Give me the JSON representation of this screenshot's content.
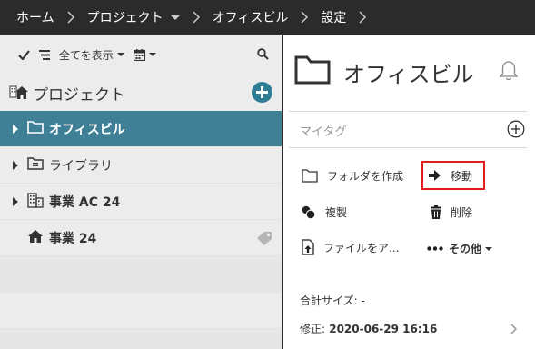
{
  "breadcrumb": {
    "home": "ホーム",
    "project": "プロジェクト",
    "folder": "オフィスビル",
    "settings": "設定"
  },
  "toolbar": {
    "show_all_label": "全てを表示"
  },
  "tree": {
    "root_label": "プロジェクト",
    "items": [
      {
        "label": "オフィスビル",
        "selected": true
      },
      {
        "label": "ライブラリ",
        "selected": false
      },
      {
        "label": "事業 AC 24",
        "selected": false
      },
      {
        "label": "事業 24",
        "selected": false
      }
    ]
  },
  "detail": {
    "title": "オフィスビル",
    "mytag_placeholder": "マイタグ",
    "actions": {
      "create_folder": "フォルダを作成",
      "move": "移動",
      "copy": "複製",
      "delete": "削除",
      "file": "ファイルをア...",
      "other": "その他"
    },
    "total_size_label": "合計サイズ:",
    "total_size_value": " -",
    "modified_label": "修正:",
    "modified_value": " 2020-06-29 16:16"
  },
  "colors": {
    "topbar": "#2b2b2b",
    "selected_row": "#3f8097",
    "accent_button": "#2f7d95",
    "highlight_border": "#e01e1e"
  }
}
